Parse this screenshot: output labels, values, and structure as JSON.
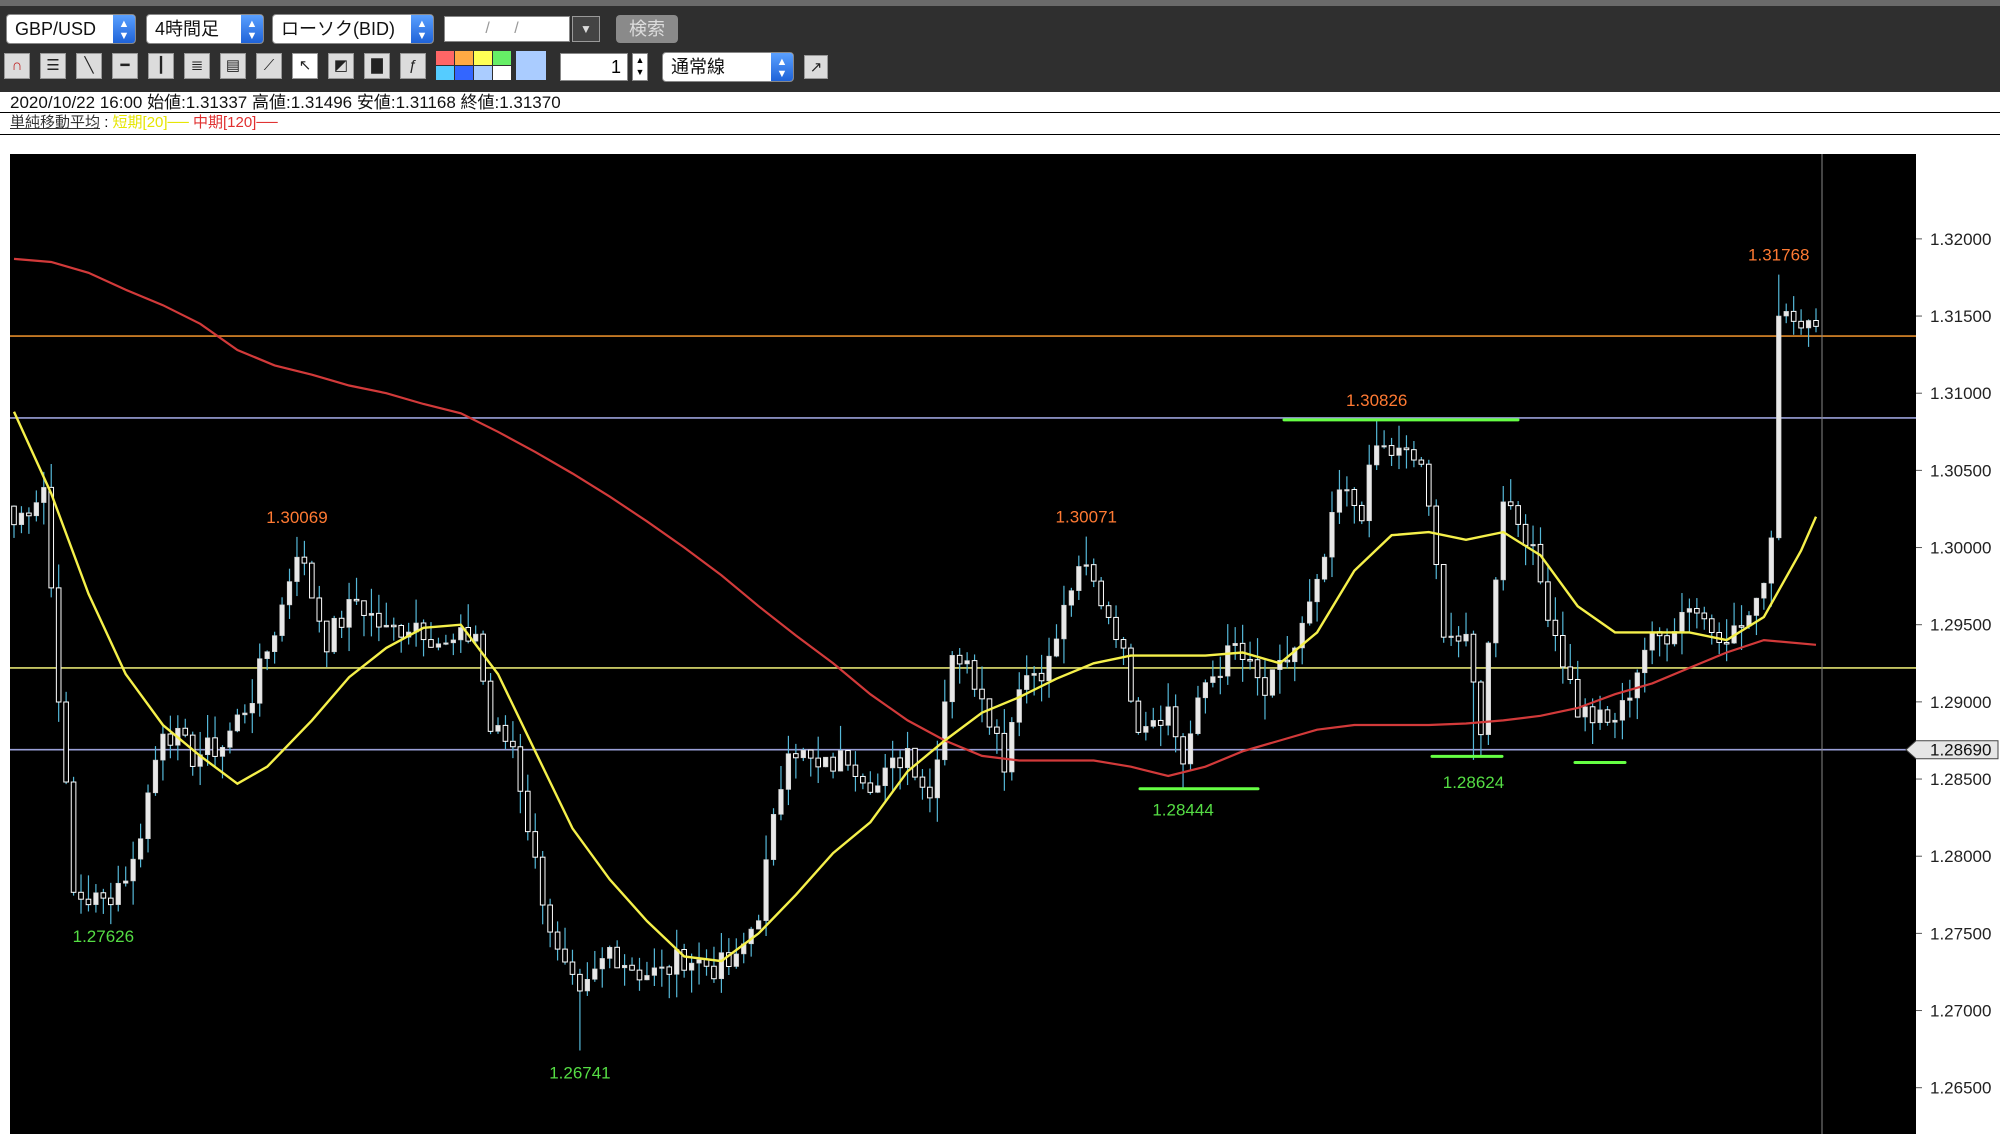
{
  "toolbar": {
    "symbol": "GBP/USD",
    "timeframe": "4時間足",
    "chart_type": "ローソク(BID)",
    "date_placeholder": "/ /",
    "search_label": "検索",
    "line_width": "1",
    "line_style": "通常線",
    "tool_icons": [
      "magnet-icon",
      "hline-settings-icon",
      "trend-line-icon",
      "horizontal-line-icon",
      "vertical-line-icon",
      "fibonacci-icon",
      "channel-icon",
      "fan-icon",
      "cursor-icon",
      "eraser-icon",
      "trash-icon",
      "text-icon"
    ],
    "palette_colors": [
      "#ff6666",
      "#ffaa44",
      "#ffff55",
      "#66ee66",
      "#55ccff",
      "#3366ff",
      "#aaccff",
      "#ffffff"
    ]
  },
  "info": {
    "ohlc": "2020/10/22 16:00 始値:1.31337 高値:1.31496 安値:1.31168 終値:1.31370",
    "ma_label": "単純移動平均",
    "ma_colon": ":",
    "ma_short": "短期[20]──",
    "ma_mid": "中期[120]──"
  },
  "colors": {
    "background": "#000000",
    "candle_up": "#e8e8e8",
    "candle_down": "#ffffff",
    "wick": "#55b8d8",
    "ma_short": "#f5f04a",
    "ma_mid": "#d23a3a",
    "high_label": "#ff7a33",
    "low_label": "#55dd44",
    "green_mark": "#66ff44"
  },
  "chart_data": {
    "type": "candlestick",
    "symbol": "GBP/USD",
    "timeframe": "4時間足",
    "ylim": [
      1.262,
      1.3255
    ],
    "y_ticks": [
      1.32,
      1.315,
      1.31,
      1.305,
      1.3,
      1.295,
      1.29,
      1.285,
      1.28,
      1.275,
      1.27,
      1.265
    ],
    "y_tick_labels": [
      "1.32000",
      "1.31500",
      "1.31000",
      "1.30500",
      "1.30000",
      "1.29500",
      "1.29000",
      "1.28500",
      "1.28000",
      "1.27500",
      "1.27000",
      "1.26500"
    ],
    "current_price": 1.2869,
    "current_price_label": "1.28690",
    "horizontal_lines": [
      {
        "price": 1.3137,
        "color": "#e08a2a"
      },
      {
        "price": 1.3084,
        "color": "#9aa0d8"
      },
      {
        "price": 1.2922,
        "color": "#e0e070"
      },
      {
        "price": 1.2869,
        "color": "#9aa0d8"
      }
    ],
    "annotations": [
      {
        "text": "1.30069",
        "price": 1.30069,
        "index": 38,
        "kind": "high"
      },
      {
        "text": "1.30071",
        "price": 1.30071,
        "index": 144,
        "kind": "high"
      },
      {
        "text": "1.30826",
        "price": 1.30826,
        "index": 183,
        "kind": "high"
      },
      {
        "text": "1.31768",
        "price": 1.31768,
        "index": 237,
        "kind": "high"
      },
      {
        "text": "1.27626",
        "price": 1.27626,
        "index": 12,
        "kind": "low"
      },
      {
        "text": "1.26741",
        "price": 1.26741,
        "index": 76,
        "kind": "low"
      },
      {
        "text": "1.28444",
        "price": 1.28444,
        "index": 157,
        "kind": "low"
      },
      {
        "text": "1.28624",
        "price": 1.28624,
        "index": 196,
        "kind": "low"
      }
    ],
    "ma_short_points": [
      [
        0,
        1.3088
      ],
      [
        5,
        1.3035
      ],
      [
        10,
        1.297
      ],
      [
        15,
        1.2918
      ],
      [
        20,
        1.2885
      ],
      [
        25,
        1.2865
      ],
      [
        30,
        1.2847
      ],
      [
        34,
        1.2858
      ],
      [
        40,
        1.2888
      ],
      [
        45,
        1.2916
      ],
      [
        50,
        1.2935
      ],
      [
        55,
        1.2948
      ],
      [
        60,
        1.295
      ],
      [
        65,
        1.2918
      ],
      [
        70,
        1.2868
      ],
      [
        75,
        1.2818
      ],
      [
        80,
        1.2785
      ],
      [
        85,
        1.2758
      ],
      [
        90,
        1.2735
      ],
      [
        95,
        1.2732
      ],
      [
        100,
        1.275
      ],
      [
        105,
        1.2775
      ],
      [
        110,
        1.2802
      ],
      [
        115,
        1.2822
      ],
      [
        120,
        1.2855
      ],
      [
        125,
        1.2875
      ],
      [
        130,
        1.2893
      ],
      [
        135,
        1.2903
      ],
      [
        140,
        1.2915
      ],
      [
        145,
        1.2925
      ],
      [
        150,
        1.293
      ],
      [
        155,
        1.293
      ],
      [
        160,
        1.293
      ],
      [
        165,
        1.2932
      ],
      [
        170,
        1.2925
      ],
      [
        175,
        1.2945
      ],
      [
        180,
        1.2985
      ],
      [
        185,
        1.3008
      ],
      [
        190,
        1.301
      ],
      [
        195,
        1.3005
      ],
      [
        200,
        1.301
      ],
      [
        205,
        1.2995
      ],
      [
        210,
        1.2962
      ],
      [
        215,
        1.2945
      ],
      [
        220,
        1.2945
      ],
      [
        225,
        1.2945
      ],
      [
        230,
        1.294
      ],
      [
        235,
        1.2955
      ],
      [
        240,
        1.2998
      ],
      [
        242,
        1.302
      ]
    ],
    "ma_mid_points": [
      [
        0,
        1.3187
      ],
      [
        5,
        1.3185
      ],
      [
        10,
        1.3178
      ],
      [
        15,
        1.3167
      ],
      [
        20,
        1.3157
      ],
      [
        25,
        1.3145
      ],
      [
        30,
        1.3128
      ],
      [
        35,
        1.3118
      ],
      [
        40,
        1.3112
      ],
      [
        45,
        1.3105
      ],
      [
        50,
        1.31
      ],
      [
        55,
        1.3093
      ],
      [
        60,
        1.3087
      ],
      [
        65,
        1.3075
      ],
      [
        70,
        1.3062
      ],
      [
        75,
        1.3048
      ],
      [
        80,
        1.3033
      ],
      [
        85,
        1.3017
      ],
      [
        90,
        1.3
      ],
      [
        95,
        1.2982
      ],
      [
        100,
        1.2962
      ],
      [
        105,
        1.2943
      ],
      [
        110,
        1.2925
      ],
      [
        115,
        1.2905
      ],
      [
        120,
        1.2888
      ],
      [
        125,
        1.2875
      ],
      [
        130,
        1.2865
      ],
      [
        135,
        1.2862
      ],
      [
        140,
        1.2862
      ],
      [
        145,
        1.2862
      ],
      [
        150,
        1.2858
      ],
      [
        155,
        1.2852
      ],
      [
        160,
        1.2858
      ],
      [
        165,
        1.2868
      ],
      [
        170,
        1.2875
      ],
      [
        175,
        1.2882
      ],
      [
        180,
        1.2885
      ],
      [
        185,
        1.2885
      ],
      [
        190,
        1.2885
      ],
      [
        195,
        1.2886
      ],
      [
        200,
        1.2888
      ],
      [
        205,
        1.2891
      ],
      [
        210,
        1.2896
      ],
      [
        215,
        1.2905
      ],
      [
        220,
        1.2912
      ],
      [
        225,
        1.2922
      ],
      [
        230,
        1.2932
      ],
      [
        235,
        1.294
      ],
      [
        242,
        1.2937
      ]
    ]
  }
}
